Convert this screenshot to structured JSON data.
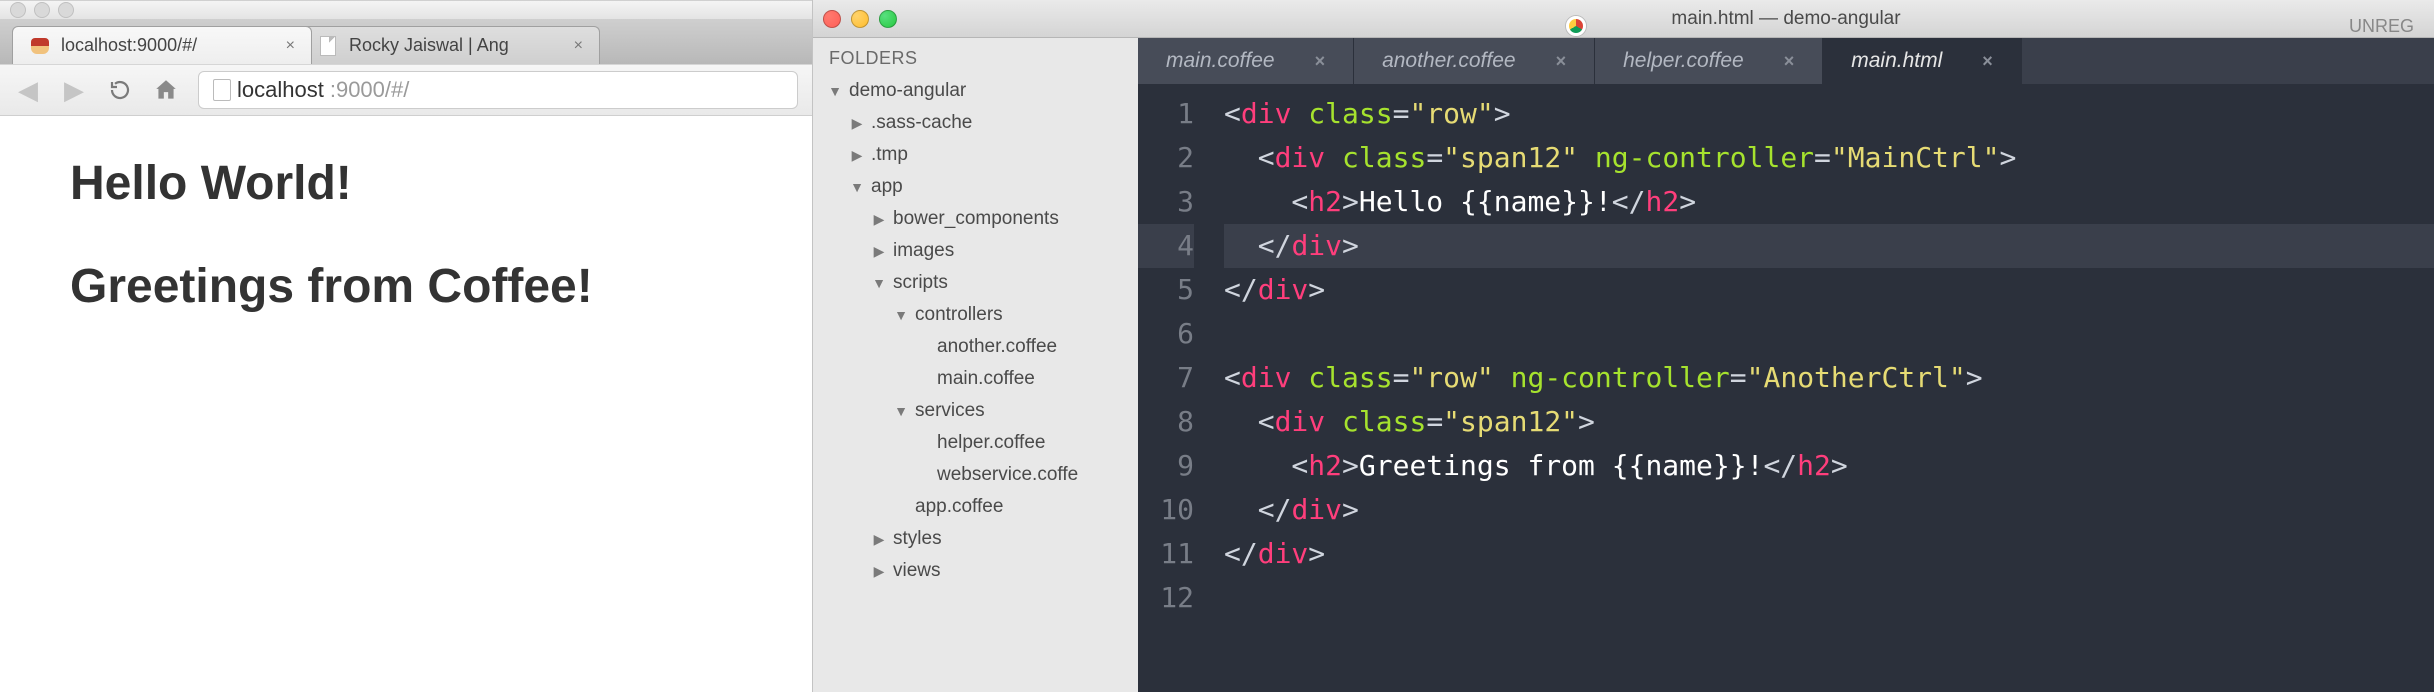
{
  "browser": {
    "tabs": [
      {
        "title": "localhost:9000/#/",
        "active": true,
        "favicon": "hat"
      },
      {
        "title": "Rocky Jaiswal | Ang",
        "active": false,
        "favicon": "doc"
      }
    ],
    "address": {
      "host": "localhost",
      "path": ":9000/#/"
    },
    "page": {
      "heading1": "Hello World!",
      "heading2": "Greetings from Coffee!"
    }
  },
  "sidebar": {
    "header": "FOLDERS",
    "tree": [
      {
        "label": "demo-angular",
        "level": 0,
        "arrow": "down"
      },
      {
        "label": ".sass-cache",
        "level": 1,
        "arrow": "right"
      },
      {
        "label": ".tmp",
        "level": 1,
        "arrow": "right"
      },
      {
        "label": "app",
        "level": 1,
        "arrow": "down"
      },
      {
        "label": "bower_components",
        "level": 2,
        "arrow": "right"
      },
      {
        "label": "images",
        "level": 2,
        "arrow": "right"
      },
      {
        "label": "scripts",
        "level": 2,
        "arrow": "down"
      },
      {
        "label": "controllers",
        "level": 3,
        "arrow": "down"
      },
      {
        "label": "another.coffee",
        "level": 4,
        "arrow": "none"
      },
      {
        "label": "main.coffee",
        "level": 4,
        "arrow": "none"
      },
      {
        "label": "services",
        "level": 3,
        "arrow": "down"
      },
      {
        "label": "helper.coffee",
        "level": 4,
        "arrow": "none"
      },
      {
        "label": "webservice.coffe",
        "level": 4,
        "arrow": "none"
      },
      {
        "label": "app.coffee",
        "level": 3,
        "arrow": "none"
      },
      {
        "label": "styles",
        "level": 2,
        "arrow": "right"
      },
      {
        "label": "views",
        "level": 2,
        "arrow": "right"
      }
    ]
  },
  "editor": {
    "title": "main.html — demo-angular",
    "unregistered": "UNREG",
    "tabs": [
      {
        "label": "main.coffee",
        "active": false
      },
      {
        "label": "another.coffee",
        "active": false
      },
      {
        "label": "helper.coffee",
        "active": false
      },
      {
        "label": "main.html",
        "active": true
      }
    ],
    "cursor_line": 4,
    "code_lines": [
      [
        {
          "t": "<",
          "c": "ang"
        },
        {
          "t": "div",
          "c": "tag"
        },
        {
          "t": " ",
          "c": "ang"
        },
        {
          "t": "class",
          "c": "attr"
        },
        {
          "t": "=",
          "c": "ang"
        },
        {
          "t": "\"row\"",
          "c": "str"
        },
        {
          "t": ">",
          "c": "ang"
        }
      ],
      [
        {
          "t": "  <",
          "c": "ang"
        },
        {
          "t": "div",
          "c": "tag"
        },
        {
          "t": " ",
          "c": "ang"
        },
        {
          "t": "class",
          "c": "attr"
        },
        {
          "t": "=",
          "c": "ang"
        },
        {
          "t": "\"span12\"",
          "c": "str"
        },
        {
          "t": " ",
          "c": "ang"
        },
        {
          "t": "ng-controller",
          "c": "attr"
        },
        {
          "t": "=",
          "c": "ang"
        },
        {
          "t": "\"MainCtrl\"",
          "c": "str"
        },
        {
          "t": ">",
          "c": "ang"
        }
      ],
      [
        {
          "t": "    <",
          "c": "ang"
        },
        {
          "t": "h2",
          "c": "tag"
        },
        {
          "t": ">",
          "c": "ang"
        },
        {
          "t": "Hello {{name}}!",
          "c": "txt"
        },
        {
          "t": "</",
          "c": "ang"
        },
        {
          "t": "h2",
          "c": "tag"
        },
        {
          "t": ">",
          "c": "ang"
        }
      ],
      [
        {
          "t": "  </",
          "c": "ang"
        },
        {
          "t": "div",
          "c": "tag"
        },
        {
          "t": ">",
          "c": "ang"
        }
      ],
      [
        {
          "t": "</",
          "c": "ang"
        },
        {
          "t": "div",
          "c": "tag"
        },
        {
          "t": ">",
          "c": "ang"
        }
      ],
      [],
      [
        {
          "t": "<",
          "c": "ang"
        },
        {
          "t": "div",
          "c": "tag"
        },
        {
          "t": " ",
          "c": "ang"
        },
        {
          "t": "class",
          "c": "attr"
        },
        {
          "t": "=",
          "c": "ang"
        },
        {
          "t": "\"row\"",
          "c": "str"
        },
        {
          "t": " ",
          "c": "ang"
        },
        {
          "t": "ng-controller",
          "c": "attr"
        },
        {
          "t": "=",
          "c": "ang"
        },
        {
          "t": "\"AnotherCtrl\"",
          "c": "str"
        },
        {
          "t": ">",
          "c": "ang"
        }
      ],
      [
        {
          "t": "  <",
          "c": "ang"
        },
        {
          "t": "div",
          "c": "tag"
        },
        {
          "t": " ",
          "c": "ang"
        },
        {
          "t": "class",
          "c": "attr"
        },
        {
          "t": "=",
          "c": "ang"
        },
        {
          "t": "\"span12\"",
          "c": "str"
        },
        {
          "t": ">",
          "c": "ang"
        }
      ],
      [
        {
          "t": "    <",
          "c": "ang"
        },
        {
          "t": "h2",
          "c": "tag"
        },
        {
          "t": ">",
          "c": "ang"
        },
        {
          "t": "Greetings from {{name}}!",
          "c": "txt"
        },
        {
          "t": "</",
          "c": "ang"
        },
        {
          "t": "h2",
          "c": "tag"
        },
        {
          "t": ">",
          "c": "ang"
        }
      ],
      [
        {
          "t": "  </",
          "c": "ang"
        },
        {
          "t": "div",
          "c": "tag"
        },
        {
          "t": ">",
          "c": "ang"
        }
      ],
      [
        {
          "t": "</",
          "c": "ang"
        },
        {
          "t": "div",
          "c": "tag"
        },
        {
          "t": ">",
          "c": "ang"
        }
      ],
      []
    ]
  }
}
